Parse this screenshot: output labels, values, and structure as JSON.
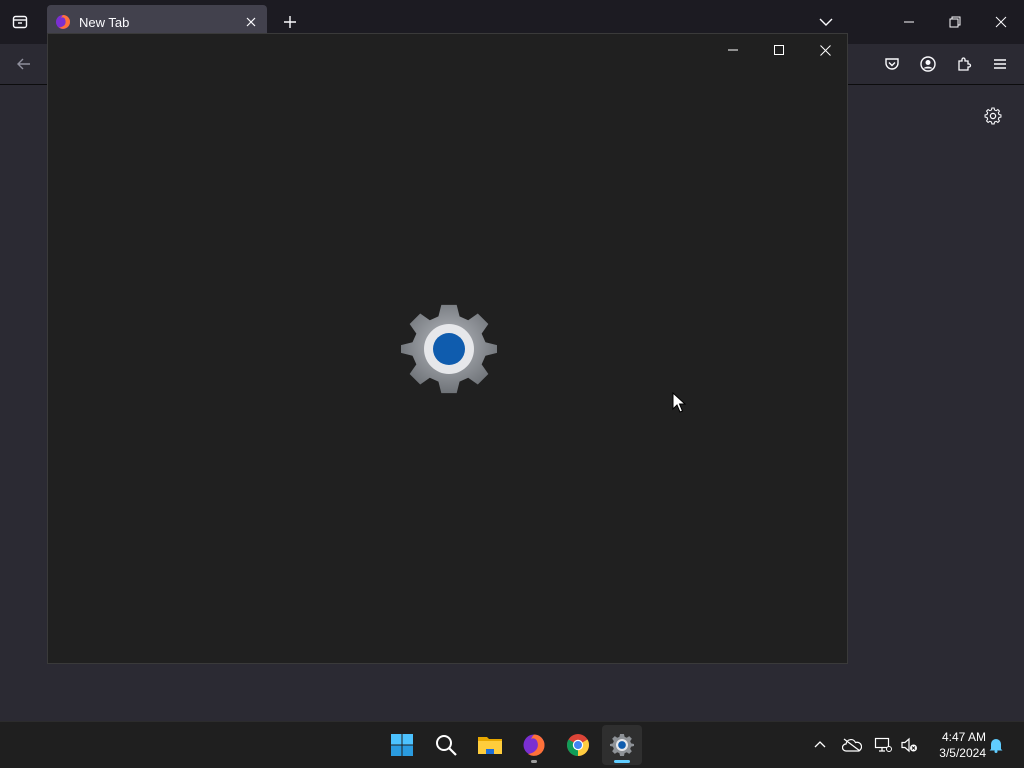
{
  "browser": {
    "tab": {
      "title": "New Tab",
      "icon": "firefox-icon"
    },
    "new_tab_icon": "plus-icon",
    "list_tabs_icon": "chevron-down-icon",
    "toolbar_icons": [
      "pocket-icon",
      "account-icon",
      "extensions-icon",
      "menu-icon"
    ],
    "settings_icon": "gear-icon"
  },
  "splash_window": {
    "app_icon": "settings-gear-icon",
    "controls": [
      "minimize-icon",
      "maximize-icon",
      "close-icon"
    ]
  },
  "taskbar": {
    "apps": [
      {
        "name": "Start",
        "icon": "windows-start-icon"
      },
      {
        "name": "Search",
        "icon": "search-icon"
      },
      {
        "name": "File Explorer",
        "icon": "folder-icon"
      },
      {
        "name": "Firefox",
        "icon": "firefox-icon"
      },
      {
        "name": "Chrome",
        "icon": "chrome-icon"
      },
      {
        "name": "Settings",
        "icon": "settings-gear-icon",
        "active": true
      }
    ],
    "tray_icons": [
      "chevron-up-icon",
      "onedrive-offline-icon",
      "network-icon",
      "volume-muted-icon"
    ],
    "clock": {
      "time": "4:47 AM",
      "date": "3/5/2024"
    },
    "notification_icon": "bell-icon"
  },
  "colors": {
    "accent": "#60cdff",
    "settings_gear_blue": "#0f5cae",
    "window_bg": "#202020",
    "browser_bg": "#2b2a33"
  }
}
